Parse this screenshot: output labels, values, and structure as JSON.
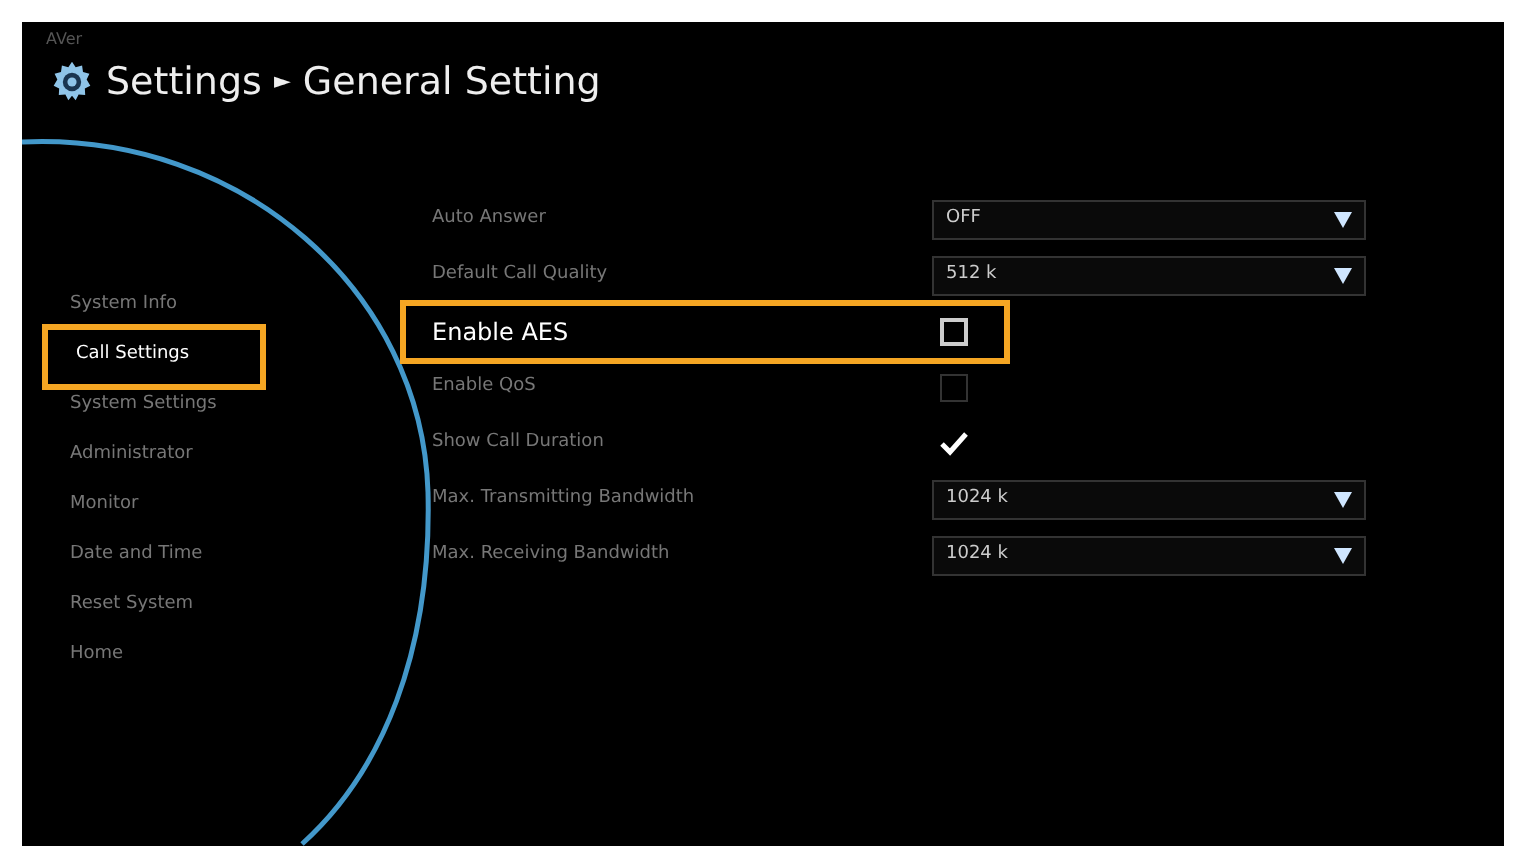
{
  "logo": "AVer",
  "breadcrumb": {
    "root": "Settings",
    "separator": "►",
    "current": "General Setting"
  },
  "sidebar": {
    "items": [
      {
        "label": "System Info",
        "selected": false
      },
      {
        "label": "Call Settings",
        "selected": true
      },
      {
        "label": "System Settings",
        "selected": false
      },
      {
        "label": "Administrator",
        "selected": false
      },
      {
        "label": "Monitor",
        "selected": false
      },
      {
        "label": "Date and Time",
        "selected": false
      },
      {
        "label": "Reset System",
        "selected": false
      },
      {
        "label": "Home",
        "selected": false
      }
    ]
  },
  "settings": [
    {
      "kind": "dropdown",
      "label": "Auto Answer",
      "value": "OFF",
      "selected": false
    },
    {
      "kind": "dropdown",
      "label": "Default Call Quality",
      "value": "512 k",
      "selected": false
    },
    {
      "kind": "checkbox",
      "label": "Enable AES",
      "checked": false,
      "disabled": false,
      "selected": true
    },
    {
      "kind": "checkbox",
      "label": "Enable QoS",
      "checked": false,
      "disabled": true,
      "selected": false
    },
    {
      "kind": "checkbox",
      "label": "Show Call Duration",
      "checked": true,
      "disabled": false,
      "selected": false
    },
    {
      "kind": "dropdown",
      "label": "Max. Transmitting Bandwidth",
      "value": "1024 k",
      "selected": false
    },
    {
      "kind": "dropdown",
      "label": "Max. Receiving Bandwidth",
      "value": "1024 k",
      "selected": false
    }
  ]
}
